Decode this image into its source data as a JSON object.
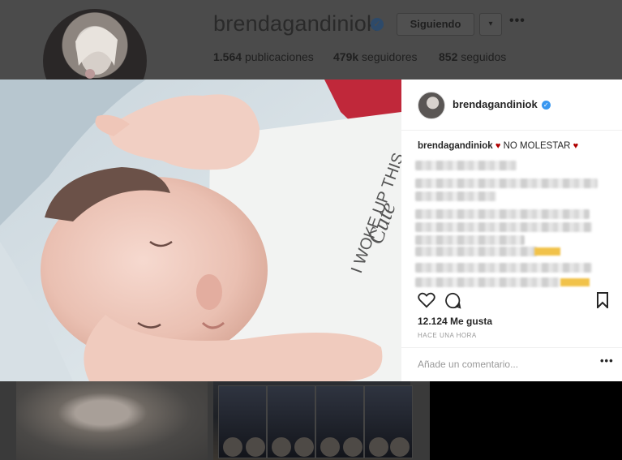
{
  "profile": {
    "username": "brendagandiniok",
    "follow_label": "Siguiendo",
    "dropdown_icon": "▾",
    "more_icon": "•••",
    "posts": "1.564",
    "posts_label": "publicaciones",
    "followers": "479k",
    "followers_label": "seguidores",
    "following": "852",
    "following_label": "seguidos"
  },
  "post": {
    "username": "brendagandiniok",
    "caption_user": "brendagandiniok",
    "caption_heart": "♥",
    "caption_text": "NO MOLESTAR",
    "shirt_text_1": "I WOKE UP THIS",
    "shirt_text_2": "Cute",
    "likes": "12.124 Me gusta",
    "time": "HACE UNA HORA",
    "comment_placeholder": "Añade un comentario...",
    "more_icon": "•••"
  },
  "colors": {
    "verified": "#3897f0",
    "heart": "#b00000",
    "dim_overlay": "#4a4a4a"
  }
}
